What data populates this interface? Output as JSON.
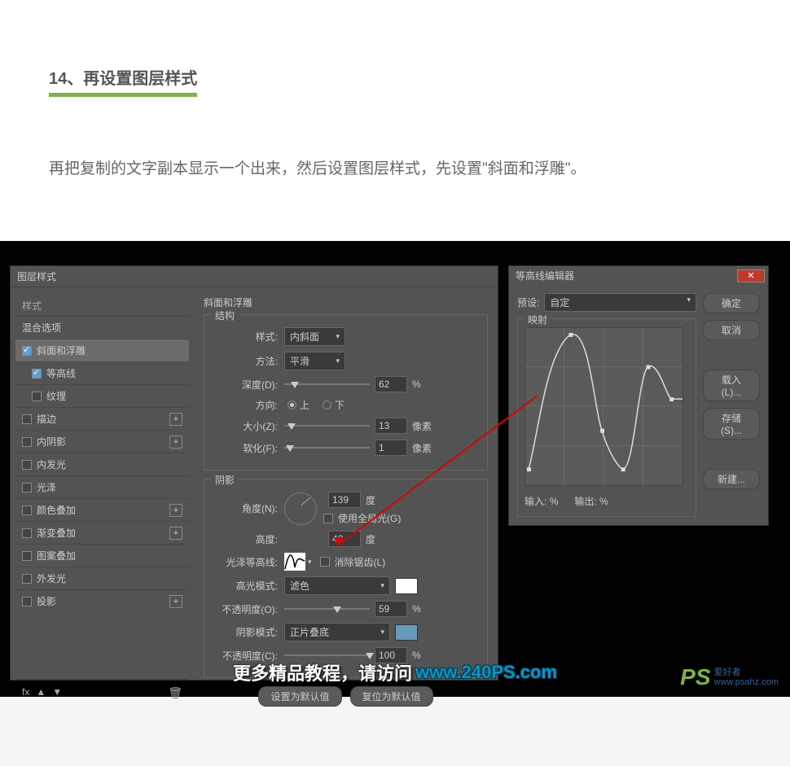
{
  "article": {
    "heading": "14、再设置图层样式",
    "body": "再把复制的文字副本显示一个出来，然后设置图层样式，先设置\"斜面和浮雕\"。"
  },
  "layer_style": {
    "title": "图层样式",
    "styles_header": "样式",
    "blend_options": "混合选项",
    "effects": {
      "bevel": {
        "label": "斜面和浮雕",
        "checked": true
      },
      "contour": {
        "label": "等高线",
        "checked": true
      },
      "texture": {
        "label": "纹理",
        "checked": false
      },
      "stroke": {
        "label": "描边",
        "checked": false
      },
      "inner_shadow": {
        "label": "内阴影",
        "checked": false
      },
      "inner_glow": {
        "label": "内发光",
        "checked": false
      },
      "satin": {
        "label": "光泽",
        "checked": false
      },
      "color_overlay": {
        "label": "颜色叠加",
        "checked": false
      },
      "gradient_overlay": {
        "label": "渐变叠加",
        "checked": false
      },
      "pattern_overlay": {
        "label": "图案叠加",
        "checked": false
      },
      "outer_glow": {
        "label": "外发光",
        "checked": false
      },
      "drop_shadow": {
        "label": "投影",
        "checked": false
      }
    },
    "fx_label": "fx",
    "bevel_panel": {
      "title": "斜面和浮雕",
      "structure": {
        "legend": "结构",
        "style_label": "样式:",
        "style_value": "内斜面",
        "technique_label": "方法:",
        "technique_value": "平滑",
        "depth_label": "深度(D):",
        "depth_value": "62",
        "depth_unit": "%",
        "direction_label": "方向:",
        "direction_up": "上",
        "direction_down": "下",
        "size_label": "大小(Z):",
        "size_value": "13",
        "size_unit": "像素",
        "soften_label": "软化(F):",
        "soften_value": "1",
        "soften_unit": "像素"
      },
      "shading": {
        "legend": "阴影",
        "angle_label": "角度(N):",
        "angle_value": "139",
        "angle_unit": "度",
        "global_light": "使用全局光(G)",
        "altitude_label": "高度:",
        "altitude_value": "42",
        "altitude_unit": "度",
        "gloss_contour_label": "光泽等高线:",
        "anti_alias": "消除锯齿(L)",
        "highlight_mode_label": "高光模式:",
        "highlight_mode_value": "滤色",
        "highlight_color": "#ffffff",
        "highlight_opacity_label": "不透明度(O):",
        "highlight_opacity_value": "59",
        "highlight_opacity_unit": "%",
        "shadow_mode_label": "阴影模式:",
        "shadow_mode_value": "正片叠底",
        "shadow_color": "#6699bb",
        "shadow_opacity_label": "不透明度(C):",
        "shadow_opacity_value": "100",
        "shadow_opacity_unit": "%"
      },
      "buttons": {
        "default": "设置为默认值",
        "reset": "复位为默认值"
      }
    }
  },
  "contour_editor": {
    "title": "等高线编辑器",
    "preset_label": "预设:",
    "preset_value": "自定",
    "mapping_legend": "映射",
    "input_label": "输入:",
    "input_unit": "%",
    "output_label": "输出:",
    "output_unit": "%",
    "buttons": {
      "ok": "确定",
      "cancel": "取消",
      "load": "载入(L)...",
      "save": "存储(S)...",
      "new": "新建..."
    }
  },
  "chart_data": {
    "type": "line",
    "title": "映射",
    "xlabel": "输入",
    "ylabel": "输出",
    "xlim": [
      0,
      100
    ],
    "ylim": [
      0,
      100
    ],
    "points": [
      {
        "x": 2,
        "y": 10
      },
      {
        "x": 10,
        "y": 40
      },
      {
        "x": 29,
        "y": 96
      },
      {
        "x": 49,
        "y": 35
      },
      {
        "x": 62,
        "y": 10
      },
      {
        "x": 78,
        "y": 75
      },
      {
        "x": 93,
        "y": 55
      },
      {
        "x": 100,
        "y": 55
      }
    ]
  },
  "footer": {
    "text_prefix": "更多精品教程，请访问",
    "link": "www.240PS.com",
    "logo": "PS",
    "logo_sub1": "爱好者",
    "logo_sub2": "www.psahz.com"
  }
}
